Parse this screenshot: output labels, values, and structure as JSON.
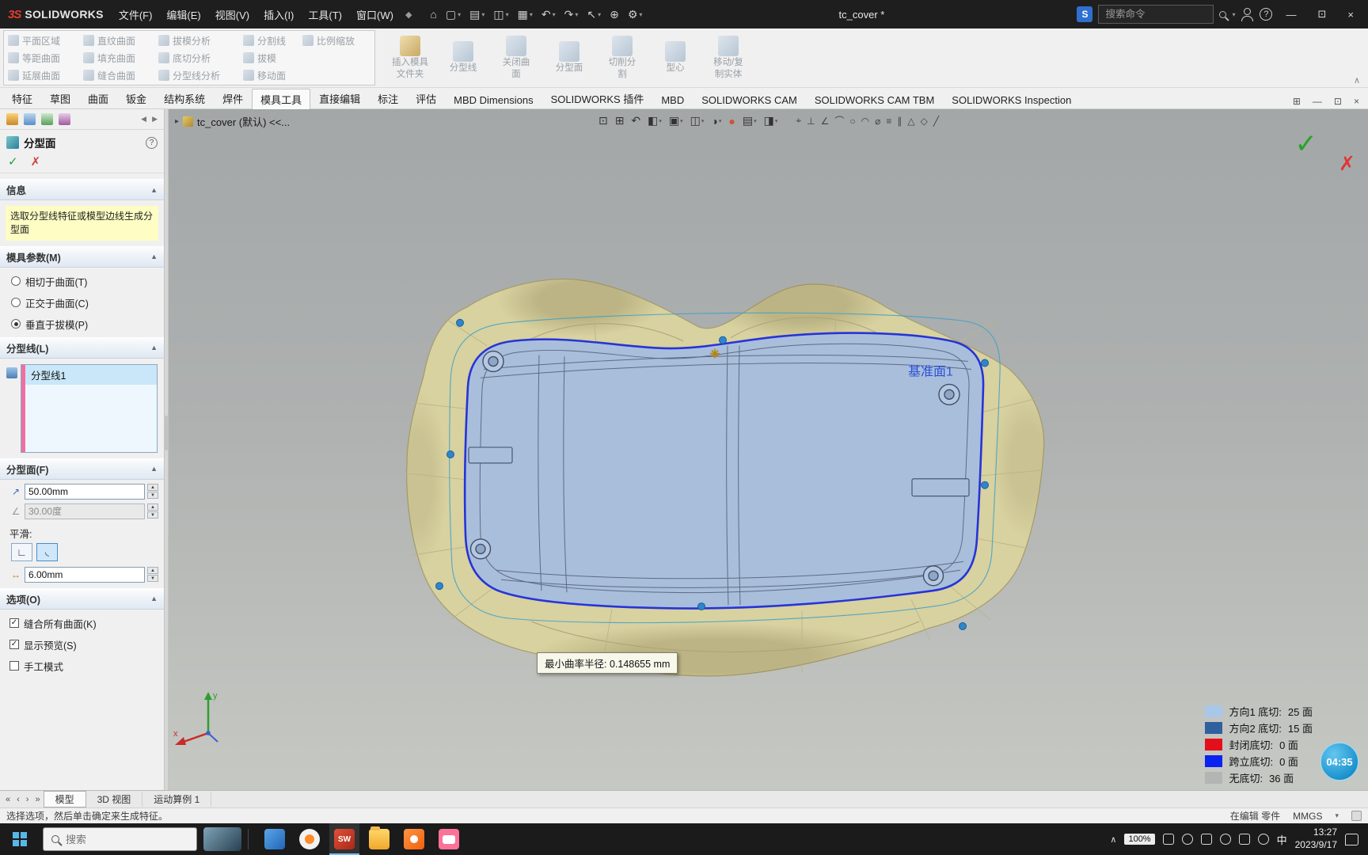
{
  "titlebar": {
    "logo_mark": "3S",
    "logo_text": "SOLIDWORKS",
    "menus": [
      "文件(F)",
      "编辑(E)",
      "视图(V)",
      "插入(I)",
      "工具(T)",
      "窗口(W)"
    ],
    "doc_title": "tc_cover *",
    "search_placeholder": "搜索命令"
  },
  "ribbon": {
    "palette": {
      "r1": [
        "平面区域",
        "直纹曲面",
        "拔模分析",
        "分割线",
        "比例缩放"
      ],
      "r2": [
        "等距曲面",
        "填充曲面",
        "底切分析",
        "拔模"
      ],
      "r3": [
        "延展曲面",
        "缝合曲面",
        "分型线分析",
        "移动面"
      ]
    },
    "large": [
      {
        "l1": "插入模具",
        "l2": "文件夹"
      },
      {
        "l1": "分型线",
        "l2": ""
      },
      {
        "l1": "关闭曲",
        "l2": "面"
      },
      {
        "l1": "分型面",
        "l2": ""
      },
      {
        "l1": "切削分",
        "l2": "割"
      },
      {
        "l1": "型心",
        "l2": ""
      },
      {
        "l1": "移动/复",
        "l2": "制实体"
      }
    ]
  },
  "tabs": [
    "特征",
    "草图",
    "曲面",
    "钣金",
    "结构系统",
    "焊件",
    "模具工具",
    "直接编辑",
    "标注",
    "评估",
    "MBD Dimensions",
    "SOLIDWORKS 插件",
    "MBD",
    "SOLIDWORKS CAM",
    "SOLIDWORKS CAM TBM",
    "SOLIDWORKS Inspection"
  ],
  "panel": {
    "title": "分型面",
    "info_header": "信息",
    "info_text": "选取分型线特征或模型边线生成分型面",
    "params_header": "模具参数(M)",
    "radio1": "相切于曲面(T)",
    "radio2": "正交于曲面(C)",
    "radio3": "垂直于拔模(P)",
    "pline_header": "分型线(L)",
    "pline_item": "分型线1",
    "psurf_header": "分型面(F)",
    "distance": "50.00mm",
    "angle": "30.00度",
    "smooth_label": "平滑:",
    "smooth_distance": "6.00mm",
    "options_header": "选项(O)",
    "check1": "缝合所有曲面(K)",
    "check2": "显示预览(S)",
    "check3": "手工模式"
  },
  "viewport": {
    "breadcrumb": "tc_cover (默认) <<...",
    "plane_label": "基准面1",
    "tooltip": "最小曲率半径: 0.148655 mm",
    "timer": "04:35",
    "legend": [
      {
        "color": "#a9c7e8",
        "label": "方向1 底切:",
        "value": "25 面"
      },
      {
        "color": "#30609e",
        "label": "方向2 底切:",
        "value": "15 面"
      },
      {
        "color": "#e3101c",
        "label": "封闭底切:",
        "value": "0 面"
      },
      {
        "color": "#0a23f0",
        "label": "跨立底切:",
        "value": "0 面"
      },
      {
        "color": "#b4b4b4",
        "label": "无底切:",
        "value": "36 面"
      }
    ]
  },
  "doctabs": [
    "模型",
    "3D 视图",
    "运动算例 1"
  ],
  "statusbar": {
    "message": "选择选项，然后单击确定来生成特征。",
    "editing": "在编辑 零件",
    "units": "MMGS"
  },
  "taskbar": {
    "search_placeholder": "搜索",
    "battery": "100%",
    "ime": "中",
    "time": "13:27",
    "date": "2023/9/17"
  }
}
